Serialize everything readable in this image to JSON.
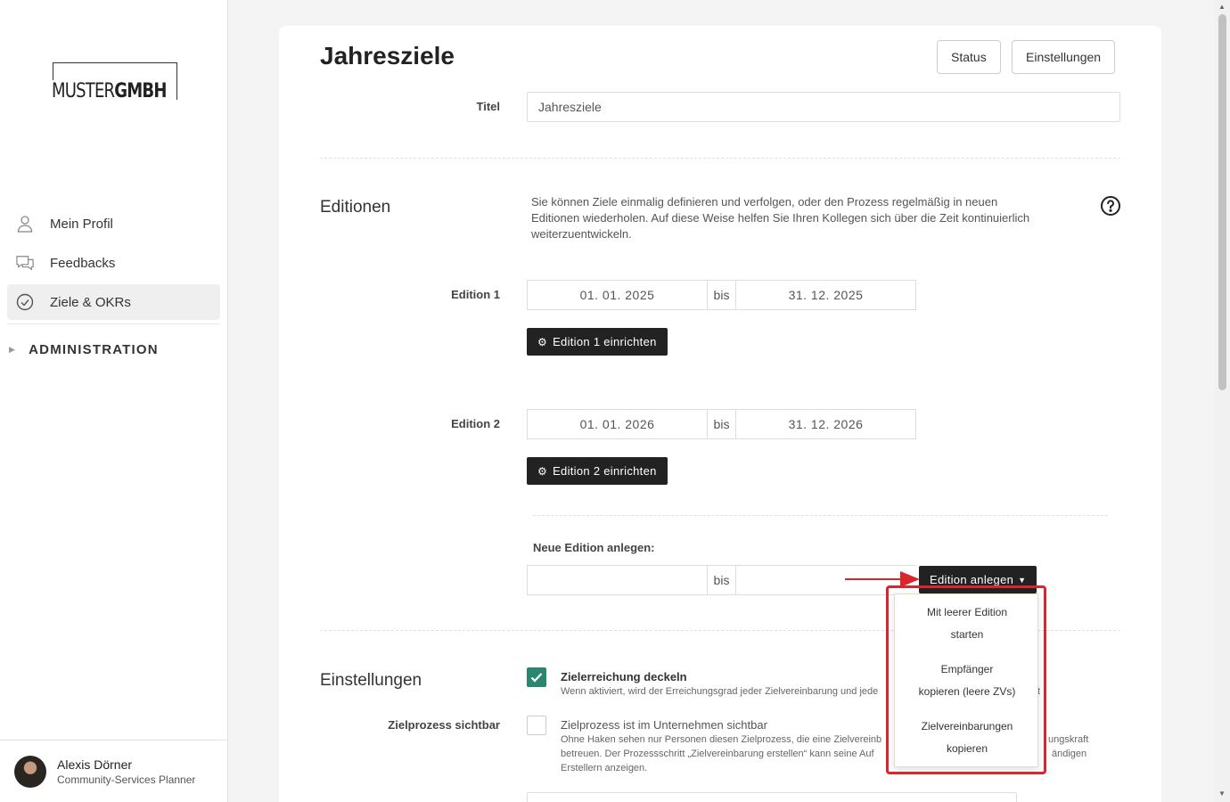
{
  "logo": {
    "part1": "MUSTER",
    "part2": "GMBH"
  },
  "nav": {
    "items": [
      {
        "label": "Mein Profil"
      },
      {
        "label": "Feedbacks"
      },
      {
        "label": "Ziele & OKRs"
      }
    ],
    "admin_label": "ADMINISTRATION"
  },
  "user": {
    "name": "Alexis Dörner",
    "role": "Community-Services Planner"
  },
  "page": {
    "title": "Jahresziele",
    "status_button": "Status",
    "settings_button": "Einstellungen",
    "title_label": "Titel",
    "title_value": "Jahresziele"
  },
  "editions": {
    "section_title": "Editionen",
    "help": "Sie können Ziele einmalig definieren und verfolgen, oder den Prozess regelmäßig in neuen Editionen wiederholen. Auf diese Weise helfen Sie Ihren Kollegen sich über die Zeit kontinuierlich weiterzuentwickeln.",
    "bis": "bis",
    "list": [
      {
        "label": "Edition 1",
        "from": "01. 01. 2025",
        "to": "31. 12. 2025",
        "button": "Edition 1 einrichten"
      },
      {
        "label": "Edition 2",
        "from": "01. 01. 2026",
        "to": "31. 12. 2026",
        "button": "Edition 2 einrichten"
      }
    ],
    "new_label": "Neue Edition anlegen:",
    "new_from": "",
    "new_to": "",
    "create_button": "Edition anlegen",
    "dropdown": [
      {
        "line1": "Mit leerer Edition",
        "line2": "starten"
      },
      {
        "line1": "Empfänger",
        "line2": "kopieren (leere ZVs)"
      },
      {
        "line1": "Zielvereinbarungen",
        "line2": "kopieren"
      }
    ]
  },
  "settings": {
    "section_title": "Einstellungen",
    "cap": {
      "label": "Zielerreichung deckeln",
      "desc": "Wenn aktiviert, wird der Erreichungsgrad jeder Zielvereinbarung und jede",
      "desc_tail": "t",
      "checked": true
    },
    "visible": {
      "row_label": "Zielprozess sichtbar",
      "label": "Zielprozess ist im Unternehmen sichtbar",
      "desc1a": "Ohne Haken sehen nur Personen diesen Zielprozess, die eine Zielvereinb",
      "desc1b": "ungskraft",
      "desc2a": "betreuen. Der Prozessschritt „Zielvereinbarung erstellen“ kann seine Auf",
      "desc2b": "ändigen",
      "desc3": "Erstellern anzeigen.",
      "checked": false
    }
  },
  "colors": {
    "accent_green": "#27876f",
    "dark_button": "#222222",
    "highlight_red": "#d9262c"
  }
}
